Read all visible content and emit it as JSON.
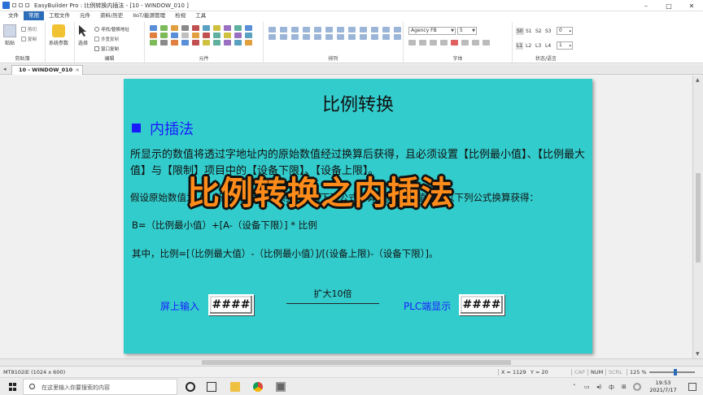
{
  "window": {
    "title": "EasyBuilder Pro : 比例转换内插法 - [10 - WINDOW_010 ]",
    "controls": [
      "–",
      "□",
      "✕"
    ]
  },
  "menu": {
    "tabs": [
      "文件",
      "常用",
      "工程文件",
      "元件",
      "资料/历史",
      "IIoT/能源管理",
      "检视",
      "工具"
    ],
    "active_index": 1
  },
  "ribbon": {
    "clipboard": {
      "paste": "粘贴",
      "cut": "剪切",
      "copy": "复制",
      "group": "剪贴簿"
    },
    "system_params": "系统参数",
    "edit": {
      "select": "选择",
      "find_replace": "寻找/替换地址",
      "multi_copy": "多重复制",
      "window_copy": "窗口复制",
      "group": "编辑"
    },
    "objects_group": "元件",
    "arrange_group": "排列",
    "font": {
      "family": "Agency FB",
      "size": "5",
      "group": "字体"
    },
    "state": {
      "states": [
        "S0",
        "S1",
        "S2",
        "S3"
      ],
      "state_value": "0",
      "langs": [
        "L1",
        "L2",
        "L3",
        "L4"
      ],
      "lang_value": "1",
      "group": "状态/语言"
    }
  },
  "doc_tab": {
    "label": "10 - WINDOW_010",
    "close": "×"
  },
  "canvas": {
    "title": "比例转换",
    "subheading": "内插法",
    "paragraph": "所显示的数值将透过字地址内的原始数值经过换算后获得，且必须设置【比例最小值】、【比例最大值】与【限制】项目中的【设备下限】、【设备上限】。",
    "paragraph2": "假设原始数值为 A，新的数值为 B，则 B 将由下列公式计算，则 B 的值可依以下列公式换算获得：",
    "formula1": "B=（比例最小值）+[A-（设备下限）] * 比例",
    "formula2": "其中，比例=[（比例最大值）-（比例最小值）]/[(设备上限)-（设备下限）]。",
    "input_label": "屏上输入",
    "input_value": "####",
    "scale_label": "扩大10倍",
    "plc_label": "PLC端显示",
    "plc_value": "####",
    "bg_color": "#33cccc",
    "accent_color": "#1a1aff"
  },
  "overlay_caption": "比例转换之内插法",
  "status": {
    "model": "MT8102iE (1024 x 600)",
    "x": "X = 1129",
    "y": "Y = 20",
    "caps": "CAP",
    "num": "NUM",
    "scrl": "SCRL",
    "zoom": "125 %",
    "zoom_level": 0.55
  },
  "taskbar": {
    "search_placeholder": "在这里输入你要搜索的内容",
    "ime": "中",
    "time": "19:53",
    "date": "2021/7/17"
  }
}
